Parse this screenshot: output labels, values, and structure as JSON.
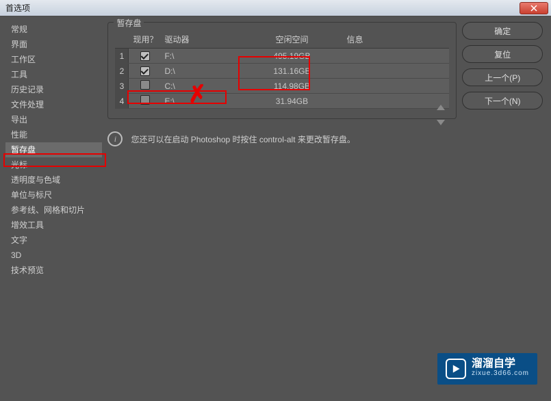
{
  "titlebar": {
    "title": "首选项"
  },
  "sidebar": {
    "items": [
      {
        "label": "常规"
      },
      {
        "label": "界面"
      },
      {
        "label": "工作区"
      },
      {
        "label": "工具"
      },
      {
        "label": "历史记录"
      },
      {
        "label": "文件处理"
      },
      {
        "label": "导出"
      },
      {
        "label": "性能"
      },
      {
        "label": "暂存盘"
      },
      {
        "label": "光标"
      },
      {
        "label": "透明度与色域"
      },
      {
        "label": "单位与标尺"
      },
      {
        "label": "参考线、网格和切片"
      },
      {
        "label": "增效工具"
      },
      {
        "label": "文字"
      },
      {
        "label": "3D"
      },
      {
        "label": "技术预览"
      }
    ],
    "selected_index": 8
  },
  "panel": {
    "title": "暂存盘",
    "headers": {
      "active": "现用？",
      "drive": "驱动器",
      "space": "空闲空间",
      "info": "信息"
    },
    "rows": [
      {
        "index": "1",
        "checked": true,
        "drive": "F:\\",
        "space": "495.19GB",
        "info": ""
      },
      {
        "index": "2",
        "checked": true,
        "drive": "D:\\",
        "space": "131.16GB",
        "info": ""
      },
      {
        "index": "3",
        "checked": false,
        "drive": "C:\\",
        "space": "114.98GB",
        "info": ""
      },
      {
        "index": "4",
        "checked": false,
        "drive": "E:\\",
        "space": "31.94GB",
        "info": ""
      }
    ],
    "hint": "您还可以在启动 Photoshop 时按住 control-alt 来更改暂存盘。"
  },
  "buttons": {
    "ok": "确定",
    "reset": "复位",
    "prev": "上一个(P)",
    "next": "下一个(N)"
  },
  "watermark": {
    "brand": "溜溜自学",
    "url": "zixue.3d66.com"
  }
}
